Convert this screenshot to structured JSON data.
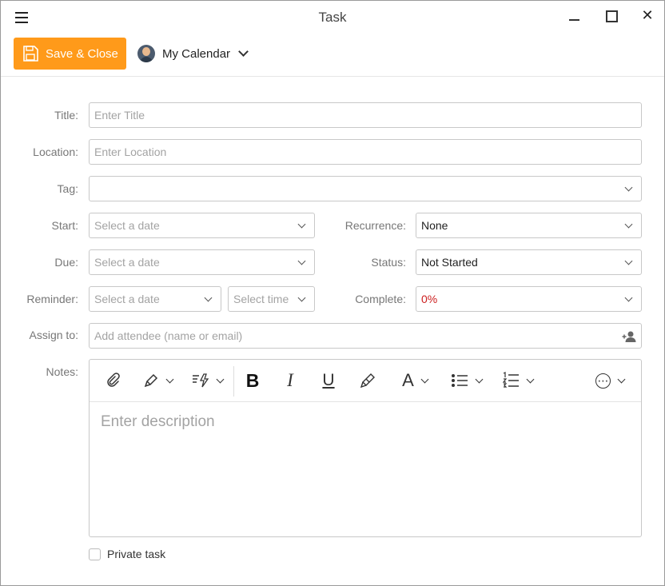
{
  "window": {
    "title": "Task",
    "close_glyph": "✕"
  },
  "toolbar": {
    "save_label": "Save & Close",
    "calendar_label": "My Calendar"
  },
  "form": {
    "title": {
      "label": "Title:",
      "placeholder": "Enter Title"
    },
    "location": {
      "label": "Location:",
      "placeholder": "Enter Location"
    },
    "tag": {
      "label": "Tag:",
      "value": ""
    },
    "start": {
      "label": "Start:",
      "placeholder": "Select a date"
    },
    "due": {
      "label": "Due:",
      "placeholder": "Select a date"
    },
    "reminder": {
      "label": "Reminder:",
      "date_placeholder": "Select a date",
      "time_placeholder": "Select time"
    },
    "recurrence": {
      "label": "Recurrence:",
      "value": "None"
    },
    "status": {
      "label": "Status:",
      "value": "Not Started"
    },
    "complete": {
      "label": "Complete:",
      "value": "0%",
      "color": "#cc1f1f"
    },
    "assign": {
      "label": "Assign to:",
      "placeholder": "Add attendee (name or email)"
    },
    "notes": {
      "label": "Notes:",
      "placeholder": "Enter description"
    },
    "private": {
      "label": "Private task",
      "checked": false
    }
  },
  "editor_toolbar": {
    "tools": [
      "paperclip-icon",
      "pen-icon",
      "format-icon",
      "bold-icon",
      "italic-icon",
      "underline-icon",
      "brush-icon",
      "font-color-icon",
      "bullet-list-icon",
      "numbered-list-icon",
      "more-icon"
    ],
    "bold_glyph": "B",
    "italic_glyph": "I",
    "underline_glyph": "U",
    "font_glyph": "A",
    "more_glyph": "⋯"
  },
  "colors": {
    "accent": "#ff9a1a",
    "border": "#c8c8c8",
    "placeholder": "#a3a3a3"
  }
}
